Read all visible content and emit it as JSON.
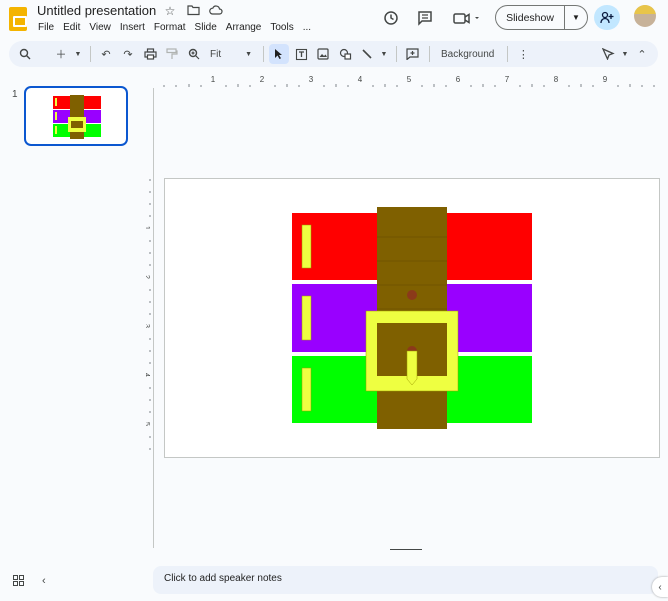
{
  "app": {
    "title": "Untitled presentation",
    "menu": [
      "File",
      "Edit",
      "View",
      "Insert",
      "Format",
      "Slide",
      "Arrange",
      "Tools",
      "..."
    ]
  },
  "header": {
    "slideshow_label": "Slideshow",
    "icons": [
      "star-icon",
      "move-folder-icon",
      "cloud-status-icon",
      "history-icon",
      "comments-icon",
      "meet-icon",
      "share-icon",
      "avatar"
    ]
  },
  "toolbar": {
    "zoom_label": "Fit",
    "background_label": "Background"
  },
  "filmstrip": {
    "slide_number": "1"
  },
  "ruler": {
    "h_labels": [
      "1",
      "2",
      "3",
      "4",
      "5",
      "6",
      "7",
      "8",
      "9"
    ],
    "v_labels": [
      "1",
      "2",
      "3",
      "4",
      "5"
    ]
  },
  "slide": {
    "colors": {
      "red": "#ff0000",
      "purple": "#9900ff",
      "green": "#00ff00",
      "belt": "#7f6000",
      "buckle": "#eeff41",
      "hole": "#8b3a1a"
    }
  },
  "notes": {
    "placeholder": "Click to add speaker notes"
  }
}
